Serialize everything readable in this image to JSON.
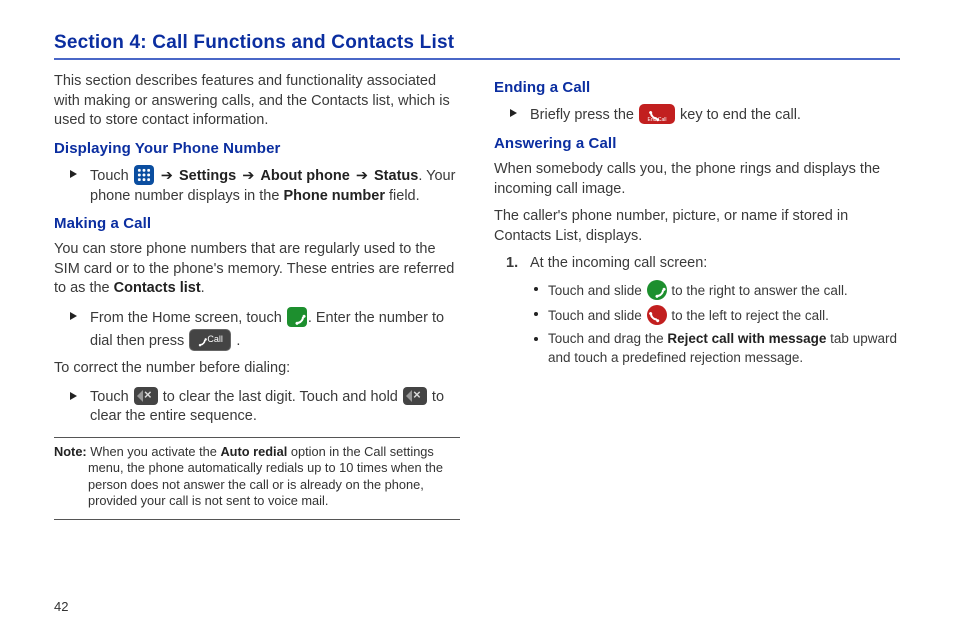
{
  "section_title": "Section 4: Call Functions and Contacts List",
  "intro": "This section describes features and functionality associated with making or answering calls, and the Contacts list, which is used to store contact information.",
  "left": {
    "h1": "Displaying Your Phone Number",
    "touch": "Touch ",
    "path1": "Settings",
    "path2": "About phone",
    "path3": "Status",
    "after_path": ". Your phone number displays in the ",
    "pn_field": "Phone number",
    "after_pn": " field.",
    "h2": "Making a Call",
    "sim": "You can store phone numbers that are regularly used to the SIM card or to the phone's memory. These entries are referred to as the ",
    "contacts": "Contacts list",
    "from_home": "From the Home screen, touch ",
    "enter": ". Enter the number to dial then press ",
    "correct": "To correct the number before dialing:",
    "clear1": " to clear the last digit. Touch and hold ",
    "clear2": " to clear the entire sequence.",
    "note_label": "Note:",
    "note_pre": " When you activate the ",
    "auto_redial": "Auto redial",
    "note_post": " option in the Call settings menu, the phone automatically redials up to 10 times when the person does not answer the call or is already on the phone, provided your call is not sent to voice mail.",
    "call_label": "Call",
    "end_label": "End Call"
  },
  "right": {
    "h1": "Ending a Call",
    "end_pre": "Briefly press the ",
    "end_post": " key to end the call.",
    "h2": "Answering a Call",
    "p1": "When somebody calls you, the phone rings and displays the incoming call image.",
    "p2": "The caller's phone number, picture, or name if stored in Contacts List, displays.",
    "step_num": "1.",
    "step": "At the incoming call screen:",
    "b1_pre": "Touch and slide ",
    "b1_post": " to the right to answer the call.",
    "b2_pre": "Touch and slide ",
    "b2_post": " to the left to reject the call.",
    "b3_pre": "Touch and drag the ",
    "b3_bold": "Reject call with message",
    "b3_post": " tab upward and touch a predefined rejection message."
  },
  "page_number": "42"
}
